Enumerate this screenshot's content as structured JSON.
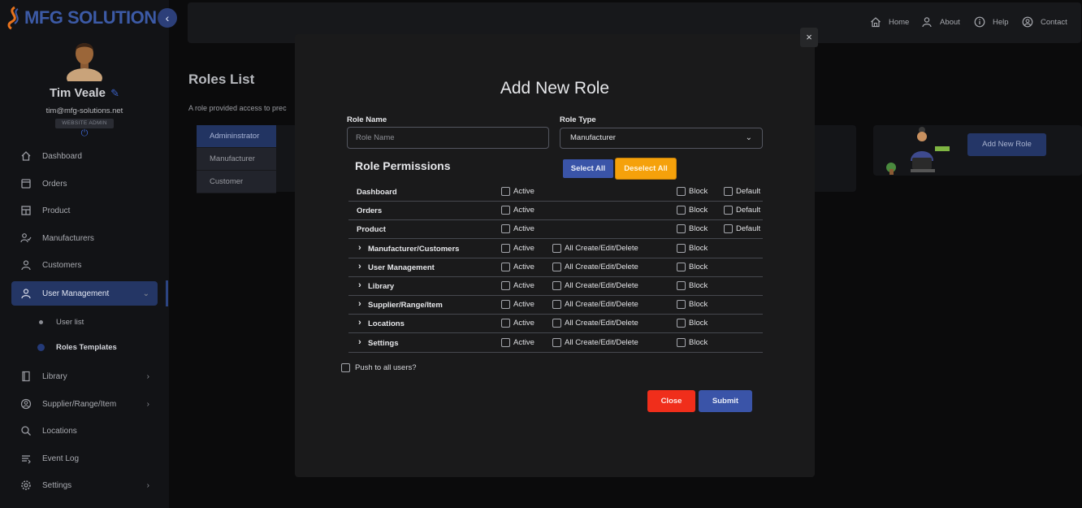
{
  "brand": {
    "name": "MFG SOLUTION"
  },
  "user": {
    "name": "Tim Veale",
    "email": "tim@mfg-solutions.net",
    "role_badge": "WEBSITE ADMIN"
  },
  "sidebar": {
    "items": [
      {
        "label": "Dashboard",
        "icon": "home-icon"
      },
      {
        "label": "Orders",
        "icon": "orders-icon"
      },
      {
        "label": "Product",
        "icon": "product-icon"
      },
      {
        "label": "Manufacturers",
        "icon": "manufacturers-icon"
      },
      {
        "label": "Customers",
        "icon": "customers-icon"
      },
      {
        "label": "User Management",
        "icon": "user-icon"
      },
      {
        "label": "Library",
        "icon": "library-icon"
      },
      {
        "label": "Supplier/Range/Item",
        "icon": "supplier-icon"
      },
      {
        "label": "Locations",
        "icon": "search-icon"
      },
      {
        "label": "Event Log",
        "icon": "event-log-icon"
      },
      {
        "label": "Settings",
        "icon": "gear-icon"
      }
    ],
    "sub_items": [
      {
        "label": "User list"
      },
      {
        "label": "Roles Templates"
      }
    ]
  },
  "topnav": {
    "links": [
      {
        "label": "Home",
        "icon": "home-icon"
      },
      {
        "label": "About",
        "icon": "person-icon"
      },
      {
        "label": "Help",
        "icon": "info-icon"
      },
      {
        "label": "Contact",
        "icon": "contact-icon"
      }
    ]
  },
  "page": {
    "title": "Roles List",
    "subtitle": "A role provided access to prec",
    "roles": [
      "Admininstrator",
      "Manufacturer",
      "Customer"
    ],
    "add_role_button": "Add New Role"
  },
  "modal": {
    "title": "Add New Role",
    "role_name_label": "Role Name",
    "role_name_placeholder": "Role Name",
    "role_type_label": "Role Type",
    "role_type_value": "Manufacturer",
    "permissions_title": "Role Permissions",
    "select_all": "Select All",
    "deselect_all": "Deselect All",
    "columns": {
      "active": "Active",
      "crud": "All Create/Edit/Delete",
      "block": "Block",
      "default": "Default"
    },
    "permissions": [
      {
        "name": "Dashboard",
        "expandable": false,
        "has_crud": false,
        "has_default": true
      },
      {
        "name": "Orders",
        "expandable": false,
        "has_crud": false,
        "has_default": true
      },
      {
        "name": "Product",
        "expandable": false,
        "has_crud": false,
        "has_default": true
      },
      {
        "name": "Manufacturer/Customers",
        "expandable": true,
        "has_crud": true,
        "has_default": false
      },
      {
        "name": "User Management",
        "expandable": true,
        "has_crud": true,
        "has_default": false
      },
      {
        "name": "Library",
        "expandable": true,
        "has_crud": true,
        "has_default": false
      },
      {
        "name": "Supplier/Range/Item",
        "expandable": true,
        "has_crud": true,
        "has_default": false
      },
      {
        "name": "Locations",
        "expandable": true,
        "has_crud": true,
        "has_default": false
      },
      {
        "name": "Settings",
        "expandable": true,
        "has_crud": true,
        "has_default": false
      }
    ],
    "push_label": "Push to all users?",
    "close_button": "Close",
    "submit_button": "Submit",
    "close_icon": "×"
  },
  "colors": {
    "primary": "#3a54a8",
    "warning": "#f5a10b",
    "danger": "#f02e1b",
    "background": "#0b0b0c",
    "modal": "#1a1a1b"
  }
}
